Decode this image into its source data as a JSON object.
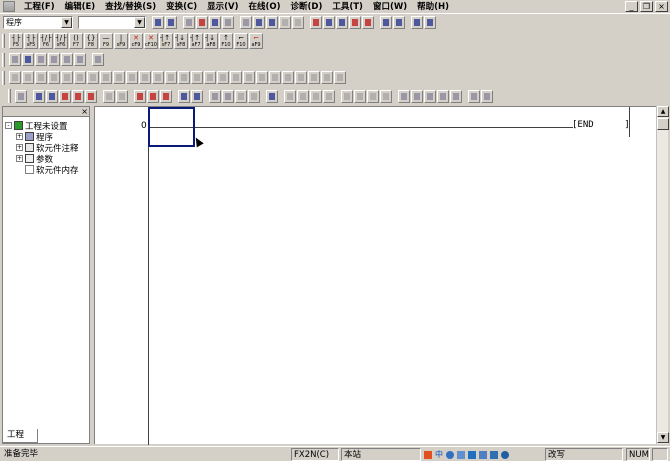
{
  "menubar": {
    "items": [
      "工程(F)",
      "编辑(E)",
      "查找/替换(S)",
      "变换(C)",
      "显示(V)",
      "在线(O)",
      "诊断(D)",
      "工具(T)",
      "窗口(W)",
      "帮助(H)"
    ]
  },
  "toolbar": {
    "program_type": "程序",
    "second_combo": ""
  },
  "ladder_toolbar": {
    "buttons": [
      "F5",
      "sF5",
      "F6",
      "sF6",
      "F7",
      "F8",
      "F9",
      "sF9",
      "cF9",
      "cF10",
      "sF7",
      "sF8",
      "aF7",
      "aF8",
      "F10",
      "aF9"
    ]
  },
  "project_panel": {
    "close_label": "×",
    "tree": [
      {
        "label": "工程未设置",
        "expander": "-",
        "icon": "project-icon"
      },
      {
        "label": "程序",
        "expander": "+",
        "icon": "program-icon"
      },
      {
        "label": "软元件注释",
        "expander": "+",
        "icon": "comment-icon"
      },
      {
        "label": "参数",
        "expander": "+",
        "icon": "parameter-icon"
      },
      {
        "label": "软元件内存",
        "expander": "",
        "icon": "memory-icon"
      }
    ],
    "tab": "工程"
  },
  "editor": {
    "step": "0",
    "end_label": "[END",
    "end_bracket": "]"
  },
  "statusbar": {
    "message": "准备完毕",
    "plc_type": "FX2N(C)",
    "station": "本站",
    "mode": "改写",
    "num": "NUM"
  },
  "window_controls": {
    "minimize": "_",
    "restore": "❐",
    "close": "×"
  }
}
